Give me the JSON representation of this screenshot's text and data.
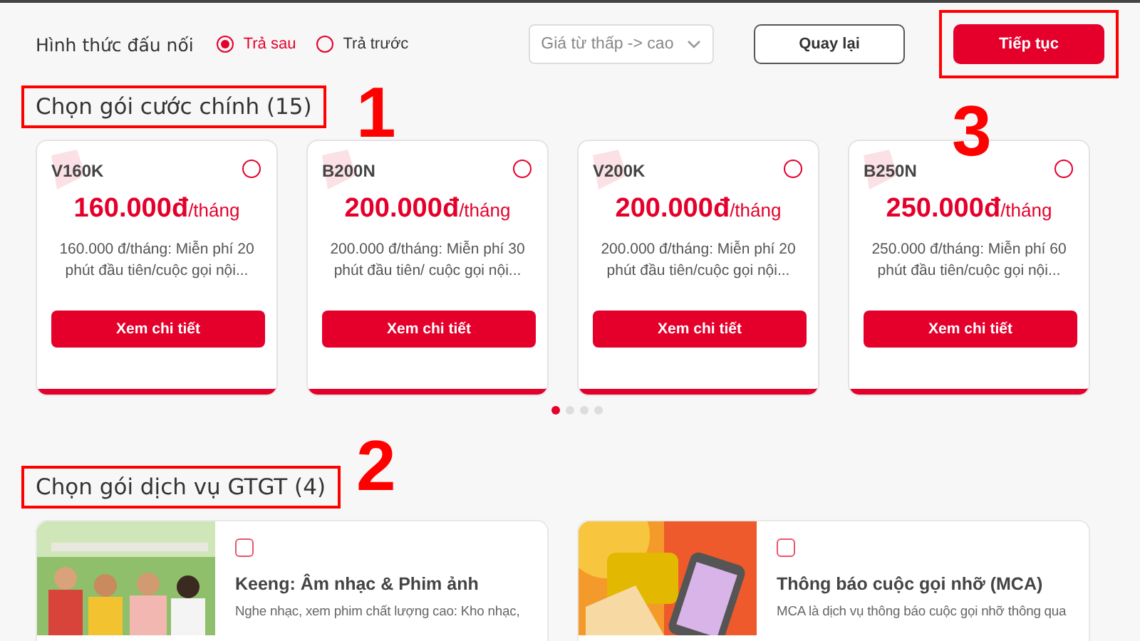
{
  "connection": {
    "label": "Hình thức đấu nối",
    "options": [
      {
        "label": "Trả sau",
        "selected": true
      },
      {
        "label": "Trả trước",
        "selected": false
      }
    ]
  },
  "sort_select": {
    "value": "Giá từ thấp -> cao"
  },
  "buttons": [
    {
      "kind": "secondary",
      "label": "Quay lại",
      "framed": false
    },
    {
      "kind": "primary",
      "label": "Tiếp tục",
      "framed": true
    }
  ],
  "main_plans": {
    "title": "Chọn gói cước chính (15)",
    "framed": true,
    "plans": [
      {
        "code": "V160K",
        "price": "160.000đ",
        "unit": "/tháng",
        "description": "160.000 đ/tháng: Miễn phí 20 phút đầu tiên/cuộc gọi nội...",
        "button": "Xem chi tiết",
        "selected": false
      },
      {
        "code": "B200N",
        "price": "200.000đ",
        "unit": "/tháng",
        "description": "200.000 đ/tháng: Miễn phí 30 phút đầu tiên/ cuộc gọi nội...",
        "button": "Xem chi tiết",
        "selected": false
      },
      {
        "code": "V200K",
        "price": "200.000đ",
        "unit": "/tháng",
        "description": "200.000 đ/tháng: Miễn phí 20 phút đầu tiên/cuộc gọi nội...",
        "button": "Xem chi tiết",
        "selected": false
      },
      {
        "code": "B250N",
        "price": "250.000đ",
        "unit": "/tháng",
        "description": "250.000 đ/tháng: Miễn phí 60 phút đầu tiên/cuộc gọi nội...",
        "button": "Xem chi tiết",
        "selected": false
      }
    ],
    "dots": [
      {
        "selected": true
      },
      {
        "selected": false
      },
      {
        "selected": false
      },
      {
        "selected": false
      }
    ]
  },
  "services": {
    "title": "Chọn gói dịch vụ GTGT (4)",
    "framed": true,
    "items": [
      {
        "kind": "picture",
        "title": "Keeng: Âm nhạc & Phim ảnh",
        "description": "Nghe nhạc, xem phim chất lượng cao: Kho nhạc,",
        "checked": false
      },
      {
        "kind": "picture",
        "title": "Thông báo cuộc gọi nhỡ (MCA)",
        "description": "MCA là dịch vụ thông báo cuộc gọi nhỡ thông qua",
        "checked": false
      }
    ]
  },
  "annotations": [
    {
      "number": "1"
    },
    {
      "number": "2"
    },
    {
      "number": "3"
    }
  ]
}
